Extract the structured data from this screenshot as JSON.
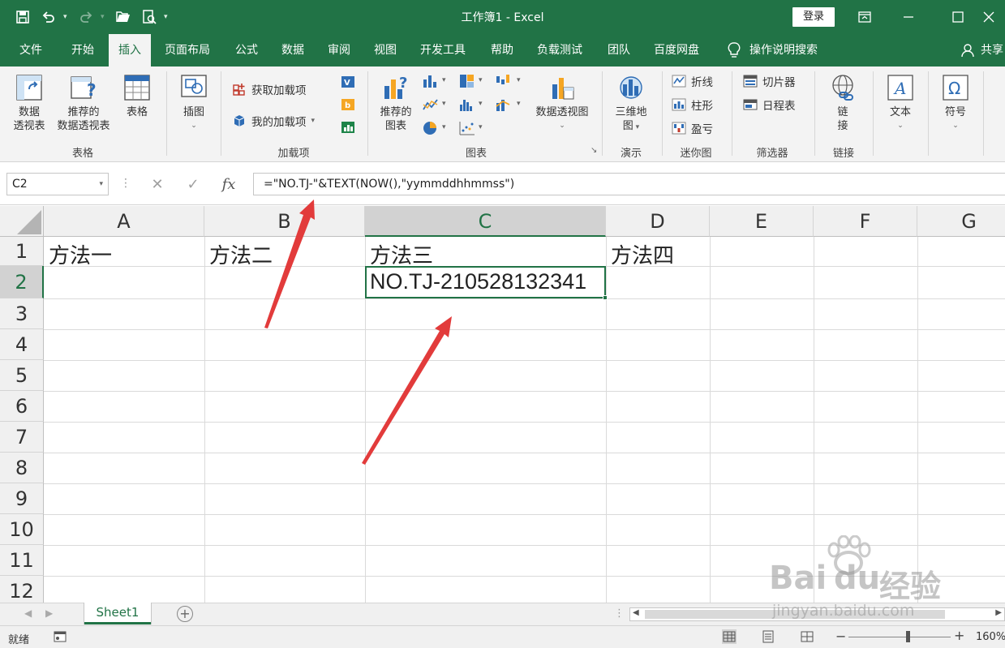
{
  "title_bar": {
    "title": "工作簿1  -  Excel",
    "login_label": "登录",
    "icons": [
      "save-icon",
      "undo-icon",
      "redo-icon",
      "open-icon",
      "print-preview-icon",
      "customize-qat-icon",
      "ribbon-display-icon",
      "minimize-icon",
      "maximize-icon",
      "close-icon"
    ]
  },
  "ribbon_tabs": {
    "items": [
      "文件",
      "开始",
      "插入",
      "页面布局",
      "公式",
      "数据",
      "审阅",
      "视图",
      "开发工具",
      "帮助",
      "负载测试",
      "团队",
      "百度网盘"
    ],
    "active": "插入",
    "tell_me": "操作说明搜索",
    "share": "共享"
  },
  "ribbon": {
    "groups": {
      "tables": "表格",
      "addins": "加载项",
      "charts": "图表",
      "tours": "演示",
      "sparklines": "迷你图",
      "filters": "筛选器",
      "links": "链接"
    },
    "pivot_table": [
      "数据",
      "透视表"
    ],
    "recommended_pivot": [
      "推荐的",
      "数据透视表"
    ],
    "table": "表格",
    "illustrations": "插图",
    "get_addins": "获取加载项",
    "my_addins": "我的加载项",
    "recommended_charts": [
      "推荐的",
      "图表"
    ],
    "pivot_chart": "数据透视图",
    "map_3d": [
      "三维地",
      "图"
    ],
    "spark_line": "折线",
    "spark_column": "柱形",
    "spark_winloss": "盈亏",
    "slicer": "切片器",
    "timeline": "日程表",
    "link": [
      "链",
      "接"
    ],
    "text": "文本",
    "symbols": "符号"
  },
  "formula_bar": {
    "name_box": "C2",
    "cancel": "✕",
    "enter": "✓",
    "fx": "fx",
    "formula": "=\"NO.TJ-\"&TEXT(NOW(),\"yymmddhhmmss\")"
  },
  "sheet": {
    "columns": [
      "A",
      "B",
      "C",
      "D",
      "E",
      "F",
      "G"
    ],
    "selected_column": "C",
    "rows": [
      "1",
      "2",
      "3",
      "4",
      "5",
      "6",
      "7",
      "8",
      "9",
      "10",
      "11",
      "12"
    ],
    "selected_row": "2",
    "cells": {
      "A1": "方法一",
      "B1": "方法二",
      "C1": "方法三",
      "D1": "方法四",
      "C2": "NO.TJ-210528132341"
    }
  },
  "sheet_tabs": {
    "tabs": [
      "Sheet1"
    ],
    "active": "Sheet1",
    "add": "+"
  },
  "status_bar": {
    "ready": "就绪",
    "zoom_minus": "−",
    "zoom_plus": "+",
    "zoom": "160%",
    "zoom_fraction": 0.58
  },
  "watermark": {
    "brand": "Bai",
    "brand2": "du",
    "suffix": "经验",
    "url": "jingyan.baidu.com"
  },
  "colors": {
    "excel_green": "#217346",
    "arrow_red": "#e23b3b"
  }
}
